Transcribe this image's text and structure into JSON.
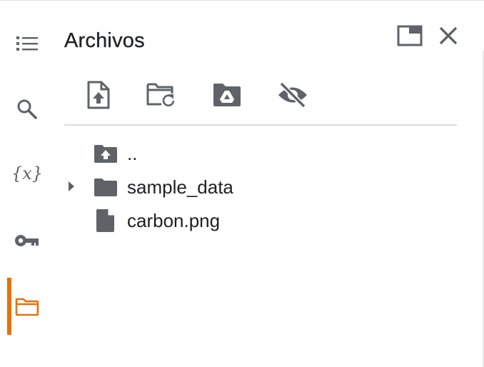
{
  "panel": {
    "title": "Archivos"
  },
  "rail": {
    "items": [
      {
        "name": "toc",
        "icon": "list-icon"
      },
      {
        "name": "search",
        "icon": "search-icon"
      },
      {
        "name": "variables",
        "icon": "variables-icon",
        "glyph": "{x}"
      },
      {
        "name": "secrets",
        "icon": "key-icon"
      },
      {
        "name": "files",
        "icon": "folder-icon",
        "active": true
      }
    ],
    "active_color": "#e8710a"
  },
  "header": {
    "maximize_icon": "maximize-icon",
    "close_icon": "close-icon"
  },
  "toolbar": {
    "buttons": [
      {
        "icon": "upload-file-icon"
      },
      {
        "icon": "refresh-folder-icon"
      },
      {
        "icon": "mount-drive-icon"
      },
      {
        "icon": "hide-files-icon"
      }
    ]
  },
  "tree": {
    "items": [
      {
        "label": "..",
        "icon": "parent-folder-icon"
      },
      {
        "label": "sample_data",
        "icon": "folder-icon",
        "expandable": true
      },
      {
        "label": "carbon.png",
        "icon": "file-icon"
      }
    ]
  },
  "colors": {
    "icon_gray": "#5f6368",
    "text": "#202124",
    "accent": "#e8710a"
  }
}
